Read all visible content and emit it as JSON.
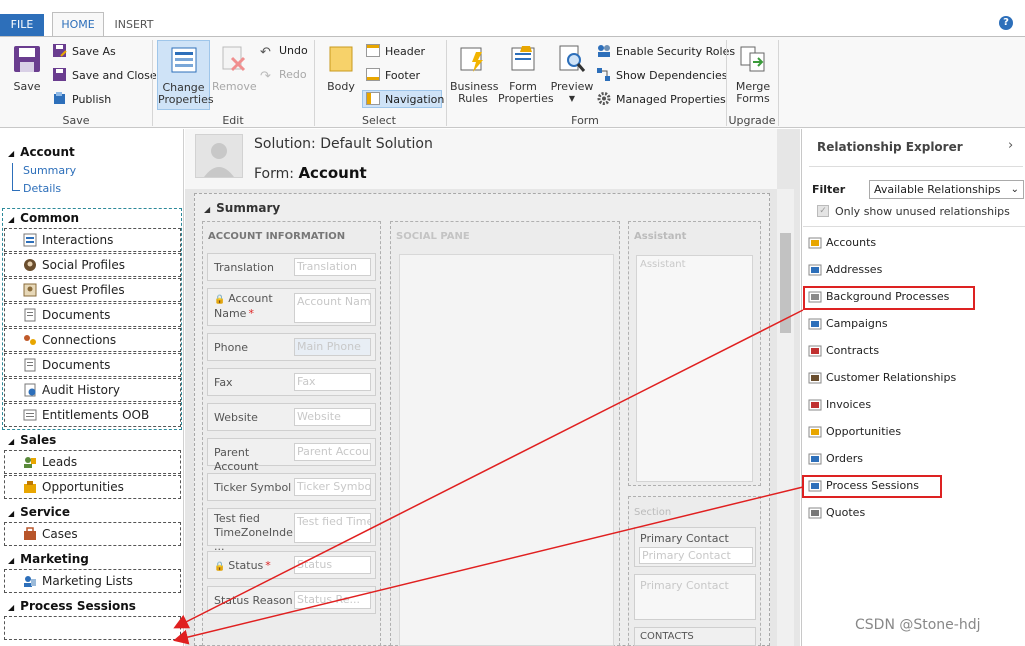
{
  "ribbon": {
    "tabs": {
      "file": "FILE",
      "home": "HOME",
      "insert": "INSERT"
    },
    "help": "?",
    "save_group": {
      "save": "Save",
      "save_as": "Save As",
      "save_and_close": "Save and Close",
      "publish": "Publish",
      "label": "Save"
    },
    "edit_group": {
      "change_properties": [
        "Change",
        "Properties"
      ],
      "remove": "Remove",
      "undo": "Undo",
      "redo": "Redo",
      "label": "Edit"
    },
    "select_group": {
      "body": "Body",
      "header": "Header",
      "footer": "Footer",
      "navigation": "Navigation",
      "label": "Select"
    },
    "form_group": {
      "business_rules": [
        "Business",
        "Rules"
      ],
      "form_properties": [
        "Form",
        "Properties"
      ],
      "preview": "Preview",
      "enable_security_roles": "Enable Security Roles",
      "show_dependencies": "Show Dependencies",
      "managed_properties": "Managed Properties",
      "label": "Form"
    },
    "upgrade_group": {
      "merge_forms": [
        "Merge",
        "Forms"
      ],
      "label": "Upgrade"
    }
  },
  "leftnav": {
    "account": {
      "title": "Account",
      "links": [
        "Summary",
        "Details"
      ]
    },
    "common": {
      "title": "Common",
      "items": [
        "Interactions",
        "Social Profiles",
        "Guest Profiles",
        "Documents",
        "Connections",
        "Documents",
        "Audit History",
        "Entitlements OOB"
      ]
    },
    "sales": {
      "title": "Sales",
      "items": [
        "Leads",
        "Opportunities"
      ]
    },
    "service": {
      "title": "Service",
      "items": [
        "Cases"
      ]
    },
    "marketing": {
      "title": "Marketing",
      "items": [
        "Marketing Lists"
      ]
    },
    "process_sessions": {
      "title": "Process Sessions"
    }
  },
  "header": {
    "solution": "Solution: Default Solution",
    "form_prefix": "Form:",
    "form_name": "Account"
  },
  "form": {
    "tab_title": "Summary",
    "sections": {
      "account_info": "ACCOUNT INFORMATION",
      "social_pane": "SOCIAL PANE",
      "assistant": "Assistant",
      "assistant_box": "Assistant",
      "section": "Section",
      "contacts": "CONTACTS"
    },
    "fields": [
      {
        "label": "Translation",
        "placeholder": "Translation",
        "required": false,
        "locked": false
      },
      {
        "label": "Account Name",
        "placeholder": "Account Name",
        "required": true,
        "locked": true
      },
      {
        "label": "Phone",
        "placeholder": "Main Phone",
        "required": false,
        "locked": false
      },
      {
        "label": "Fax",
        "placeholder": "Fax",
        "required": false,
        "locked": false
      },
      {
        "label": "Website",
        "placeholder": "Website",
        "required": false,
        "locked": false
      },
      {
        "label": "Parent Account",
        "placeholder": "Parent Account",
        "required": false,
        "locked": false
      },
      {
        "label": "Ticker Symbol",
        "placeholder": "Ticker Symbol",
        "required": false,
        "locked": false
      },
      {
        "label": "Test fied TimeZoneInde...",
        "placeholder": "Test fied Time...",
        "required": false,
        "locked": false
      },
      {
        "label": "Status",
        "placeholder": "Status",
        "required": true,
        "locked": true
      },
      {
        "label": "Status Reason",
        "placeholder": "Status Re...",
        "required": false,
        "locked": false
      }
    ],
    "primary_contact_label": "Primary Contact",
    "primary_contact_placeholder": "Primary Contact",
    "primary_contact_box": "Primary Contact"
  },
  "relationship_explorer": {
    "title": "Relationship Explorer",
    "filter_label": "Filter",
    "filter_value": "Available Relationships",
    "only_unused": "Only show unused relationships",
    "items": [
      "Accounts",
      "Addresses",
      "Background Processes",
      "Campaigns",
      "Contracts",
      "Customer Relationships",
      "Invoices",
      "Opportunities",
      "Orders",
      "Process Sessions",
      "Quotes"
    ]
  },
  "watermark": "CSDN @Stone-hdj"
}
